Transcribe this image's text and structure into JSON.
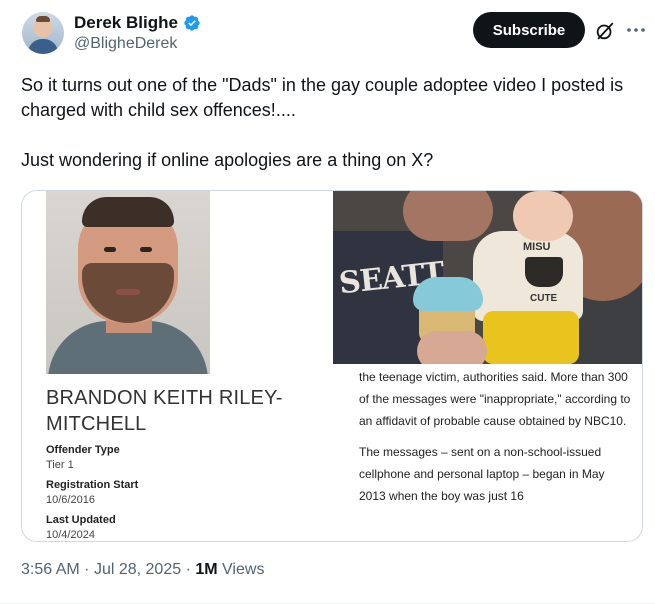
{
  "author": {
    "name": "Derek Blighe",
    "handle": "@BligheDerek",
    "verified_color": "#1d9bf0"
  },
  "actions": {
    "subscribe_label": "Subscribe",
    "grok_icon": "grok-icon",
    "more_icon": "more-options-icon"
  },
  "tweet": {
    "line1": "So it turns out one of the \"Dads\" in the gay couple adoptee video I posted is charged with child sex offences!....",
    "line2": "Just wondering if online apologies are a thing on X?"
  },
  "media": {
    "offender_name": "BRANDON KEITH RILEY-MITCHELL",
    "fields": [
      {
        "label": "Offender Type",
        "value": "Tier 1"
      },
      {
        "label": "Registration Start",
        "value": "10/6/2016"
      },
      {
        "label": "Last Updated",
        "value": "10/4/2024"
      }
    ],
    "photo_text": {
      "shirt": "SEATT",
      "misu": "MISU",
      "cute": "CUTE"
    },
    "article_p1": "the teenage victim, authorities said. More than 300 of the messages were \"inappropriate,\" according to an affidavit of probable cause obtained by NBC10.",
    "article_p2": "The messages – sent on a non-school-issued cellphone and personal laptop – began in May 2013 when the boy was just 16"
  },
  "meta": {
    "time": "3:56 AM",
    "date": "Jul 28, 2025",
    "views_count": "1M",
    "views_label": "Views"
  }
}
